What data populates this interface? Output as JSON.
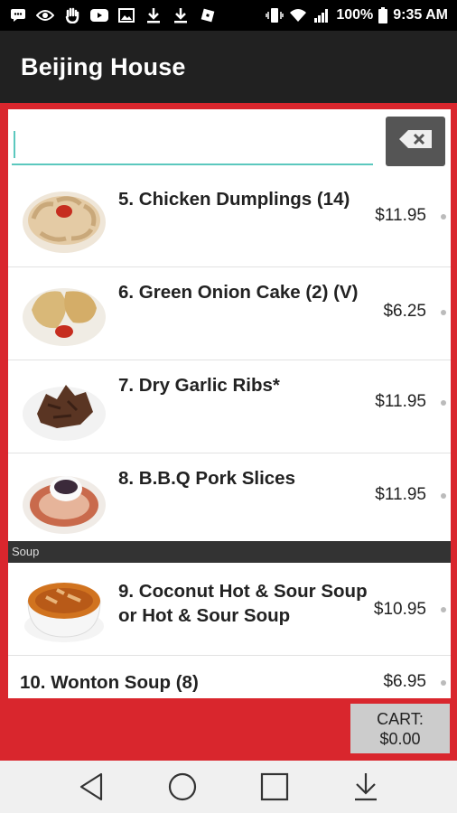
{
  "status_bar": {
    "battery": "100%",
    "time": "9:35 AM",
    "icons": [
      "message-icon",
      "eye-icon",
      "hand-icon",
      "youtube-icon",
      "image-icon",
      "download-icon",
      "download-icon",
      "roblox-icon",
      "vibrate-icon",
      "wifi-icon",
      "signal-icon",
      "battery-icon"
    ]
  },
  "app": {
    "title": "Beijing House"
  },
  "search": {
    "value": "",
    "clear_icon": "backspace-icon"
  },
  "items": [
    {
      "name": "5. Chicken Dumplings (14)",
      "price": "$11.95",
      "image": "dumplings"
    },
    {
      "name": "6. Green Onion Cake (2) (V)",
      "price": "$6.25",
      "image": "onion-cake"
    },
    {
      "name": "7. Dry Garlic Ribs*",
      "price": "$11.95",
      "image": "ribs"
    },
    {
      "name": "8. B.B.Q Pork Slices",
      "price": "$11.95",
      "image": "pork"
    }
  ],
  "section": {
    "label": "Soup"
  },
  "soup_items": [
    {
      "name": "9. Coconut Hot & Sour Soup or Hot & Sour Soup",
      "price": "$10.95",
      "image": "soup"
    },
    {
      "name": "10. Wonton Soup (8)",
      "price": "$6.95"
    }
  ],
  "cart": {
    "label": "CART:",
    "total": "$0.00"
  },
  "nav": [
    "back-icon",
    "home-icon",
    "recents-icon",
    "notification-pull-icon"
  ],
  "colors": {
    "accent_red": "#d9262d",
    "app_bar": "#212121",
    "input_underline": "#5bc8be"
  }
}
